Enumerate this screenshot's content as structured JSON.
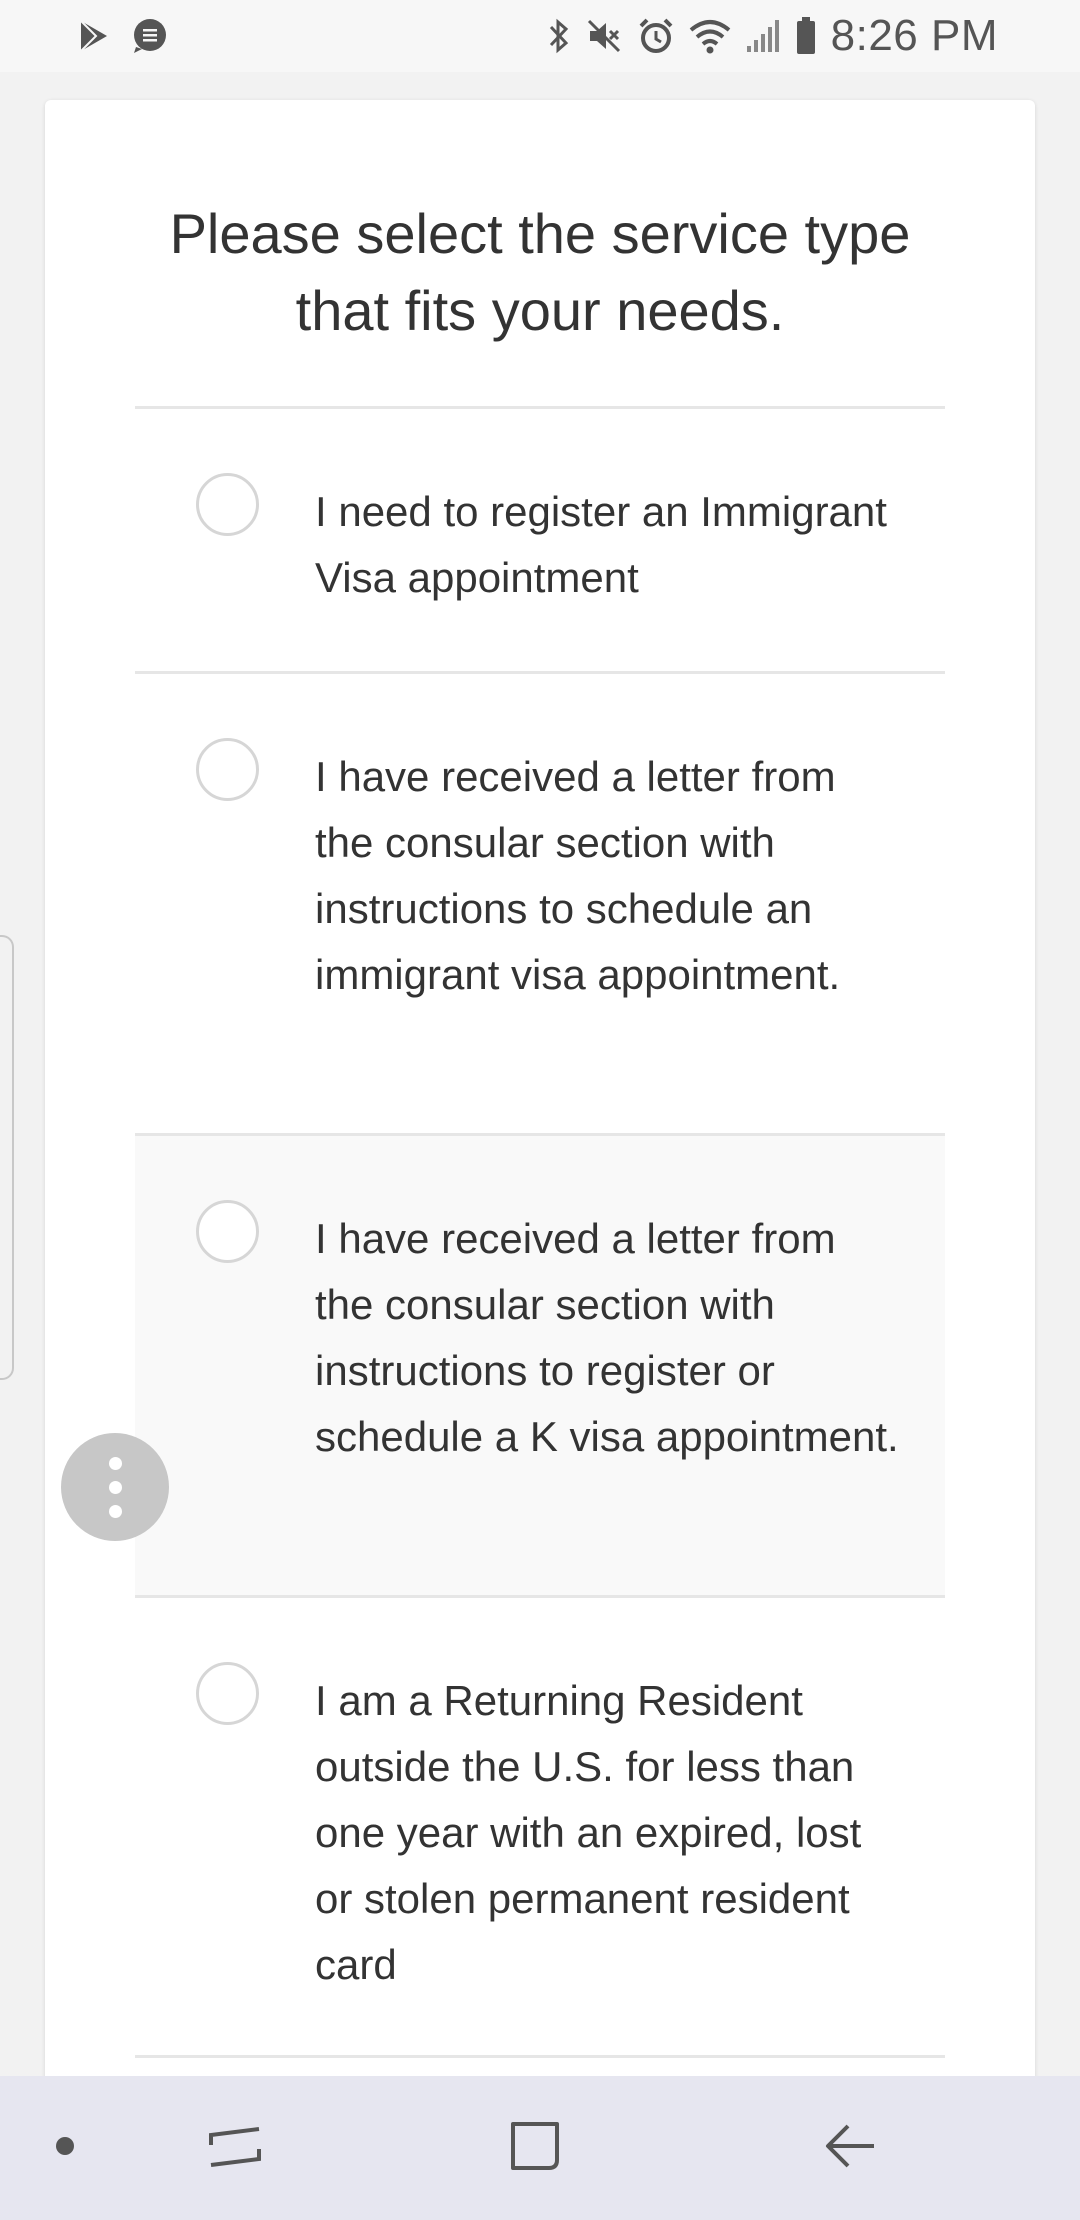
{
  "status_bar": {
    "time": "8:26 PM",
    "left_icons": [
      "play-store-icon",
      "message-icon"
    ],
    "right_icons": [
      "bluetooth-icon",
      "mute-icon",
      "alarm-icon",
      "wifi-icon",
      "signal-icon",
      "battery-icon"
    ]
  },
  "page": {
    "title": "Please select the service type\nthat fits your needs."
  },
  "options": [
    {
      "label": "I need to register an Immigrant Visa appointment"
    },
    {
      "label": "I have received a letter from the consular section with instructions to schedule an immigrant visa appointment."
    },
    {
      "label": "I have received a letter from the consular section with instructions to register or schedule a K visa appointment."
    },
    {
      "label": "I am a Returning Resident outside the U.S. for less than one year with an expired, lost or stolen permanent resident card"
    }
  ],
  "colors": {
    "background": "#f2f2f2",
    "card": "#ffffff",
    "text": "#333333",
    "highlight_row": "#f9f9f9",
    "fab": "#c7c7c7",
    "nav_bar": "#e6e6f0"
  },
  "nav_bar": {
    "buttons": [
      "dot-icon",
      "recents-icon",
      "home-icon",
      "back-icon"
    ]
  }
}
